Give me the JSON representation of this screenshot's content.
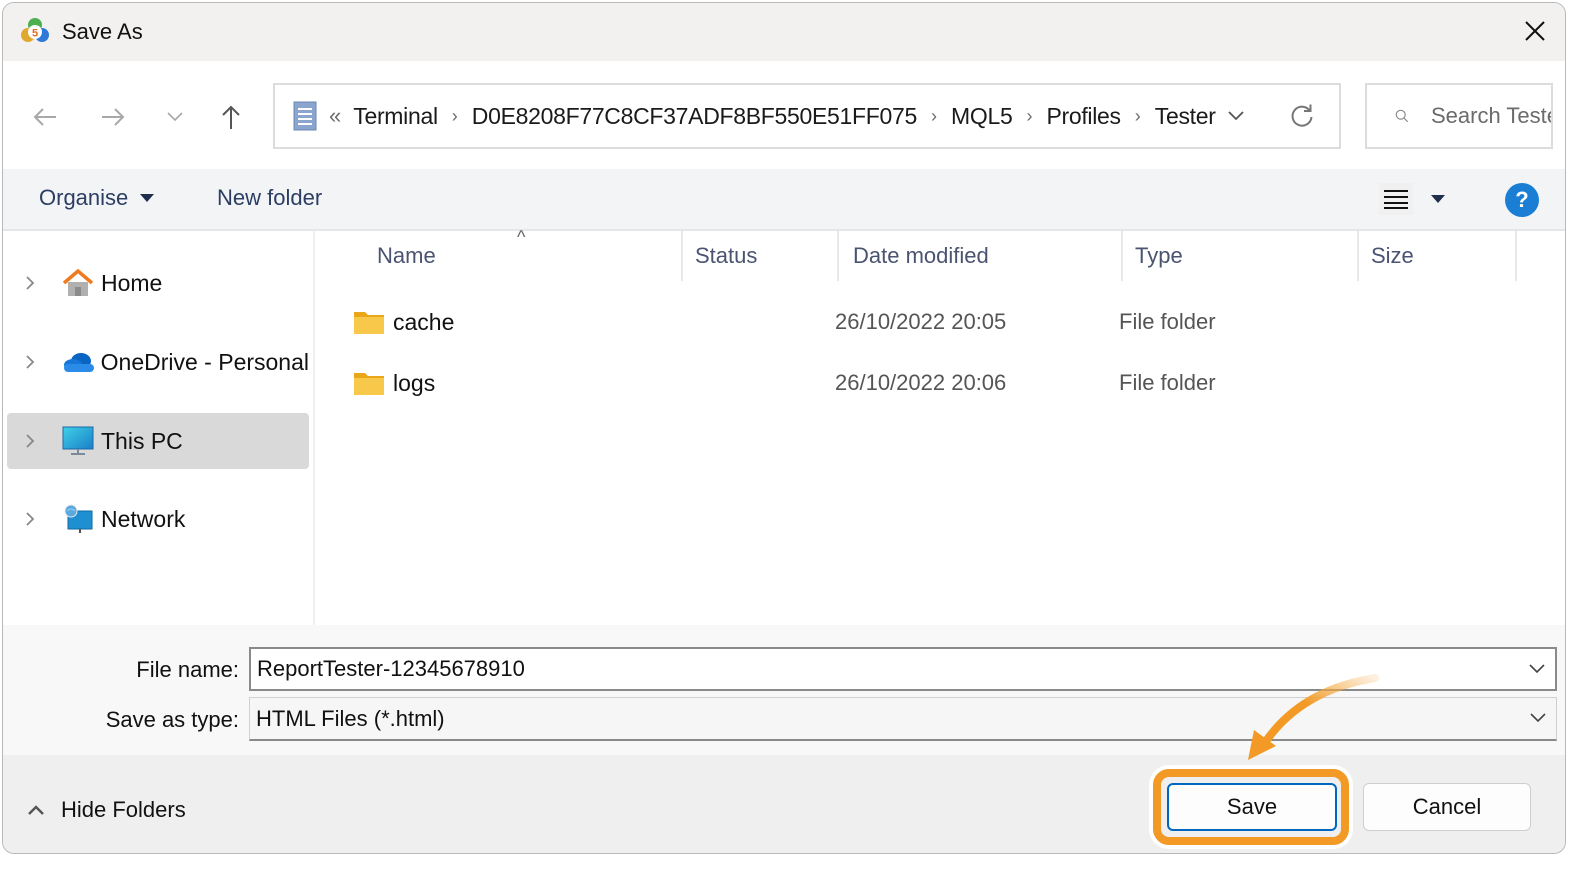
{
  "window": {
    "title": "Save As",
    "app_icon": "metatrader5-icon",
    "close_icon": "close-icon"
  },
  "navigation": {
    "back_icon": "arrow-left-icon",
    "forward_icon": "arrow-right-icon",
    "recent_icon": "chevron-down-icon",
    "up_icon": "arrow-up-icon",
    "breadcrumb_overflow": "«",
    "breadcrumbs": [
      "Terminal",
      "D0E8208F77C8CF37ADF8BF550E51FF075",
      "MQL5",
      "Profiles",
      "Tester"
    ],
    "separator": "›",
    "refresh_icon": "refresh-icon",
    "search_placeholder": "Search Tester"
  },
  "toolbar": {
    "organise_label": "Organise",
    "new_folder_label": "New folder",
    "view_icon": "list-view-icon",
    "help_icon": "help-icon",
    "help_glyph": "?"
  },
  "sidebar": {
    "items": [
      {
        "label": "Home",
        "icon": "home-icon",
        "selected": false
      },
      {
        "label": "OneDrive - Personal",
        "icon": "onedrive-cloud-icon",
        "selected": false
      },
      {
        "label": "This PC",
        "icon": "monitor-icon",
        "selected": true
      },
      {
        "label": "Network",
        "icon": "network-icon",
        "selected": false
      }
    ]
  },
  "filelist": {
    "columns": [
      "Name",
      "Status",
      "Date modified",
      "Type",
      "Size"
    ],
    "sort_indicator": "^",
    "rows": [
      {
        "name": "cache",
        "status": "",
        "date_modified": "26/10/2022 20:05",
        "type": "File folder",
        "size": ""
      },
      {
        "name": "logs",
        "status": "",
        "date_modified": "26/10/2022 20:06",
        "type": "File folder",
        "size": ""
      }
    ]
  },
  "form": {
    "file_name_label": "File name:",
    "file_name_value": "ReportTester-12345678910",
    "save_type_label": "Save as type:",
    "save_type_value": "HTML Files (*.html)"
  },
  "footer": {
    "hide_folders_label": "Hide Folders",
    "save_label": "Save",
    "cancel_label": "Cancel"
  },
  "colors": {
    "highlight": "#f29a25",
    "accent": "#0067c0",
    "help": "#1a7fd4",
    "folder": "#f5c542"
  }
}
